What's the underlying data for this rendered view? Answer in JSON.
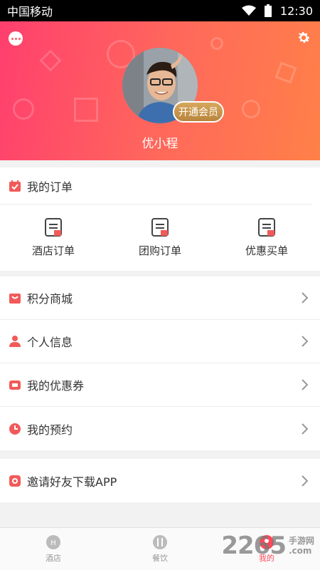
{
  "status_bar": {
    "carrier": "中国移动",
    "time": "12:30"
  },
  "profile": {
    "username": "优小程",
    "vip_label": "开通会员"
  },
  "orders": {
    "title": "我的订单",
    "items": [
      {
        "label": "酒店订单"
      },
      {
        "label": "团购订单"
      },
      {
        "label": "优惠买单"
      }
    ]
  },
  "menu_group1": [
    {
      "label": "积分商城"
    },
    {
      "label": "个人信息"
    },
    {
      "label": "我的优惠券"
    },
    {
      "label": "我的预约"
    }
  ],
  "menu_group2": [
    {
      "label": "邀请好友下载APP"
    }
  ],
  "tabbar": [
    {
      "label": "酒店",
      "active": false
    },
    {
      "label": "餐饮",
      "active": false
    },
    {
      "label": "我的",
      "active": true
    }
  ],
  "watermark": {
    "number": "2265",
    "text1": "手游网",
    "text2": ".com"
  },
  "colors": {
    "accent": "#ff4a5a",
    "header_start": "#ff3f6e",
    "header_end": "#ff8048",
    "vip_gold": "#c9954a"
  }
}
